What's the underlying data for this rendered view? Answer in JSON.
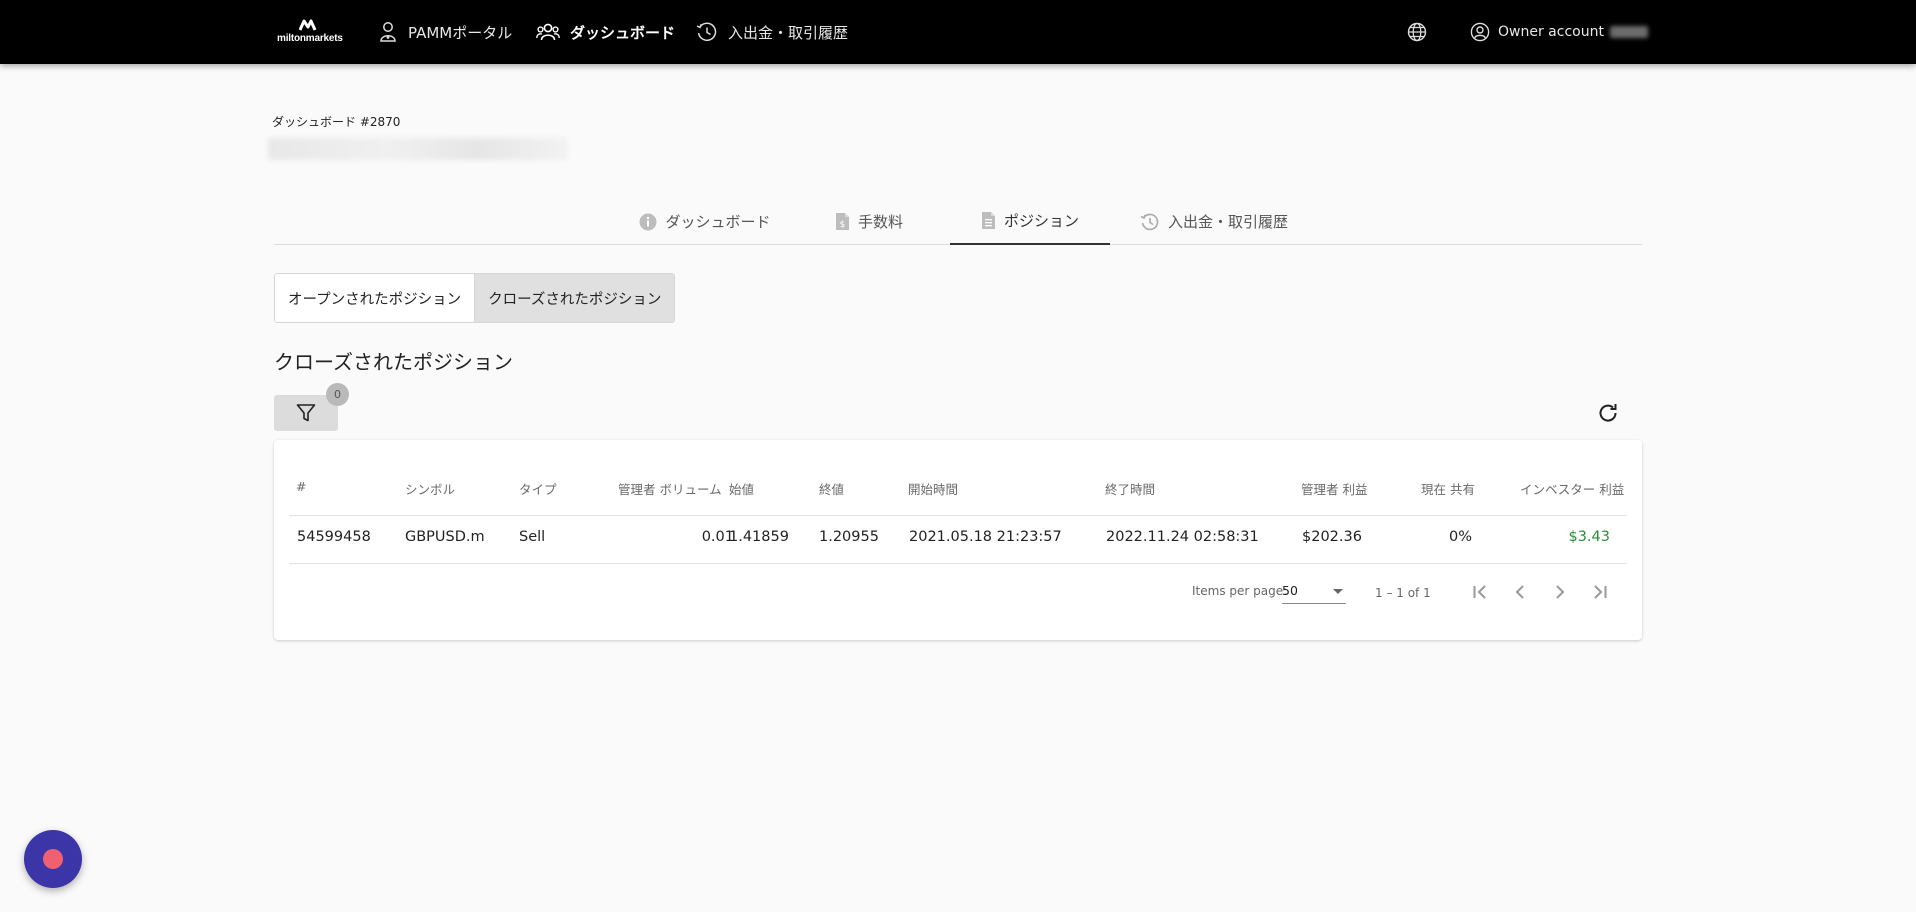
{
  "brand": {
    "logo_text": "miltonmarkets"
  },
  "nav": {
    "items": [
      {
        "label": "PAMMポータル",
        "icon": "user-icon"
      },
      {
        "label": "ダッシュボード",
        "icon": "users-icon",
        "active": true
      },
      {
        "label": "入出金・取引履歴",
        "icon": "history-icon"
      }
    ],
    "language_icon": "globe-icon",
    "account_label": "Owner account"
  },
  "page": {
    "title": "ダッシュボード #2870"
  },
  "tabs": [
    {
      "label": "ダッシュボード",
      "icon": "info-icon"
    },
    {
      "label": "手数料",
      "icon": "dollar-document-icon"
    },
    {
      "label": "ポジション",
      "icon": "document-icon",
      "active": true
    },
    {
      "label": "入出金・取引履歴",
      "icon": "history-icon"
    }
  ],
  "segments": {
    "open_label": "オープンされたポジション",
    "closed_label": "クローズされたポジション",
    "selected": "closed"
  },
  "section_title": "クローズされたポジション",
  "filter": {
    "badge_count": "0"
  },
  "table": {
    "headers": {
      "id": "#",
      "symbol": "シンボル",
      "type": "タイプ",
      "volume": "管理者 ボリューム",
      "open_price": "始値",
      "close_price": "終値",
      "open_time": "開始時間",
      "close_time": "終了時間",
      "manager_profit": "管理者 利益",
      "share": "現在 共有",
      "investor_profit": "インベスター 利益"
    },
    "rows": [
      {
        "id": "54599458",
        "symbol": "GBPUSD.m",
        "type": "Sell",
        "volume": "0.01",
        "open_price": "1.41859",
        "close_price": "1.20955",
        "open_time": "2021.05.18 21:23:57",
        "close_time": "2022.11.24 02:58:31",
        "manager_profit": "$202.36",
        "share": "0%",
        "investor_profit": "$3.43"
      }
    ]
  },
  "paginator": {
    "items_per_page_label": "Items per page:",
    "page_size": "50",
    "range_label": "1 – 1 of 1"
  },
  "colors": {
    "topbar": "#000000",
    "accent": "#333333",
    "profit": "#2e8b3a",
    "fab": "#3c35a8",
    "fab_dot": "#f06070"
  }
}
